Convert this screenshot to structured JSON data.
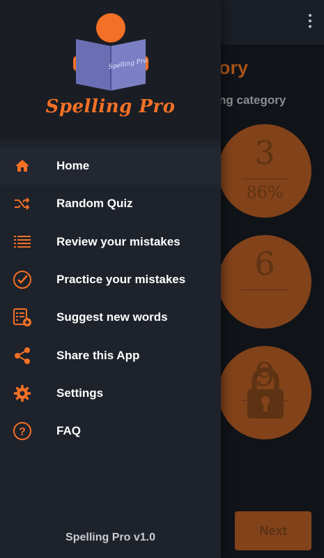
{
  "background": {
    "title": "ory",
    "subtitle": "ng category",
    "categories": [
      {
        "number": "3",
        "percent": "86%",
        "locked": false
      },
      {
        "number": "6",
        "percent": "",
        "locked": false
      },
      {
        "number": "9",
        "percent": "",
        "locked": true
      }
    ],
    "next_label": "Next"
  },
  "drawer": {
    "logo_text": "Spelling Pro",
    "book_text": "Spelling Pro",
    "items": [
      {
        "label": "Home",
        "icon": "home-icon"
      },
      {
        "label": "Random Quiz",
        "icon": "shuffle-icon"
      },
      {
        "label": "Review your mistakes",
        "icon": "list-icon"
      },
      {
        "label": "Practice your mistakes",
        "icon": "check-circle-icon"
      },
      {
        "label": "Suggest new words",
        "icon": "add-list-icon"
      },
      {
        "label": "Share this App",
        "icon": "share-icon"
      },
      {
        "label": "Settings",
        "icon": "gear-icon"
      },
      {
        "label": "FAQ",
        "icon": "help-icon"
      }
    ],
    "version": "Spelling Pro v1.0"
  },
  "colors": {
    "accent": "#f37026",
    "drawer_bg": "#1e222a",
    "header_bg": "#1a1d24",
    "dim_orange": "#82421a"
  }
}
